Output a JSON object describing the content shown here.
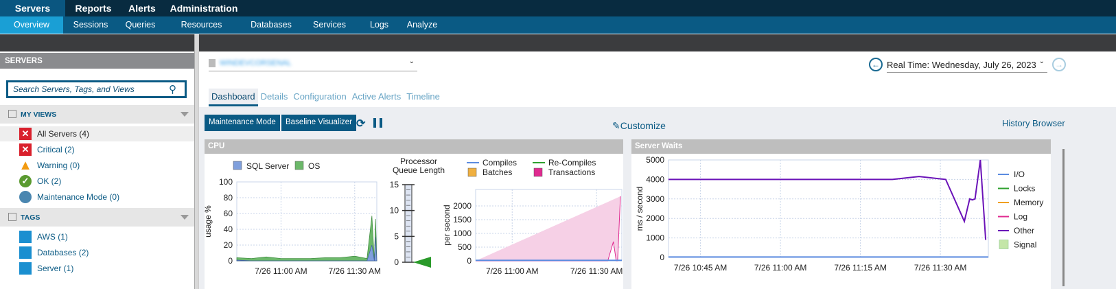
{
  "topnav": [
    "Servers",
    "Reports",
    "Alerts",
    "Administration"
  ],
  "subnav": [
    "Overview",
    "Sessions",
    "Queries",
    "Resources",
    "Databases",
    "Services",
    "Logs",
    "Analyze"
  ],
  "sidebar": {
    "title": "SERVERS",
    "search_placeholder": "Search Servers, Tags, and Views",
    "my_views": {
      "label": "MY VIEWS",
      "items": [
        {
          "label": "All Servers (4)",
          "icon": "critical-x-icon"
        },
        {
          "label": "Critical (2)",
          "icon": "critical-x-icon"
        },
        {
          "label": "Warning (0)",
          "icon": "warning-icon"
        },
        {
          "label": "OK (2)",
          "icon": "ok-check-icon"
        },
        {
          "label": "Maintenance Mode (0)",
          "icon": "maintenance-icon"
        }
      ]
    },
    "tags": {
      "label": "TAGS",
      "items": [
        {
          "label": "AWS (1)"
        },
        {
          "label": "Databases (2)"
        },
        {
          "label": "Server (1)"
        }
      ]
    }
  },
  "header": {
    "server_name": "WINDEVCORSENAL",
    "realtime": "Real Time: Wednesday, July 26, 2023"
  },
  "tabs": [
    "Dashboard",
    "Details",
    "Configuration",
    "Active Alerts",
    "Timeline"
  ],
  "toolbar": {
    "maintenance": "Maintenance Mode",
    "baseline": "Baseline Visualizer",
    "customize": "Customize",
    "history": "History Browser"
  },
  "colors": {
    "sql": "#7f9fdc",
    "os": "#6cb86a",
    "compiles": "#5b8be0",
    "recompiles": "#2ea02e",
    "batches": "#f0b040",
    "transactions": "#e02a90",
    "other": "#6a12b8",
    "signal": "#c4e6a8"
  },
  "chart_data": [
    {
      "type": "area",
      "title": "CPU",
      "ylabel": "usage %",
      "ylim": [
        0,
        100
      ],
      "yticks": [
        0,
        20,
        40,
        60,
        80,
        100
      ],
      "xlim": [
        2,
        59
      ],
      "xticks": [
        {
          "x": 20,
          "label": "7/26 11:00 AM"
        },
        {
          "x": 50,
          "label": "7/26 11:30 AM"
        }
      ],
      "legend": [
        "SQL Server",
        "OS"
      ],
      "series": [
        {
          "name": "OS",
          "x": [
            2,
            8,
            14,
            20,
            26,
            32,
            38,
            44,
            50,
            55,
            57,
            58,
            58.5,
            59
          ],
          "values": [
            4,
            3,
            5,
            3,
            3,
            3,
            4,
            4,
            6,
            3,
            57,
            1,
            53,
            0
          ]
        },
        {
          "name": "SQL Server",
          "x": [
            2,
            8,
            14,
            20,
            26,
            32,
            38,
            44,
            50,
            55,
            57,
            58,
            58.5,
            59
          ],
          "values": [
            1,
            0,
            0,
            0,
            0,
            0,
            0,
            0,
            0,
            0,
            20,
            0,
            30,
            0
          ]
        }
      ]
    },
    {
      "type": "gauge",
      "title": "Processor Queue Length",
      "ylim": [
        0,
        15
      ],
      "yticks": [
        0,
        5,
        10,
        15
      ],
      "value": 0
    },
    {
      "type": "line",
      "ylabel": "per second",
      "ylim": [
        0,
        2600
      ],
      "yticks": [
        0,
        500,
        1000,
        1500,
        2000
      ],
      "xlim": [
        7,
        59
      ],
      "xticks": [
        {
          "x": 20,
          "label": "7/26 11:00 AM"
        },
        {
          "x": 50,
          "label": "7/26 11:30 AM"
        }
      ],
      "legend": [
        "Compiles",
        "Re-Compiles",
        "Batches",
        "Transactions"
      ],
      "series": [
        {
          "name": "Transactions",
          "x": [
            7,
            54,
            56,
            57,
            57.5,
            58.5
          ],
          "values": [
            0,
            0,
            700,
            0,
            0,
            2350
          ]
        },
        {
          "name": "Compiles",
          "x": [
            7,
            59
          ],
          "values": [
            20,
            20
          ]
        }
      ]
    },
    {
      "type": "line",
      "title": "Server Waits",
      "ylabel": "ms / second",
      "ylim": [
        0,
        5000
      ],
      "yticks": [
        0,
        1000,
        2000,
        3000,
        4000,
        5000
      ],
      "xlim": [
        -6,
        54
      ],
      "xticks": [
        {
          "x": 0,
          "label": "7/26 10:45 AM"
        },
        {
          "x": 15,
          "label": "7/26 11:00 AM"
        },
        {
          "x": 30,
          "label": "7/26 11:15 AM"
        },
        {
          "x": 45,
          "label": "7/26 11:30 AM"
        }
      ],
      "legend": [
        "I/O",
        "Locks",
        "Memory",
        "Log",
        "Other",
        "Signal"
      ],
      "series": [
        {
          "name": "Other",
          "x": [
            -6,
            36,
            41,
            46,
            49.5,
            50.5,
            51,
            51.5,
            52.5,
            53.5
          ],
          "values": [
            4000,
            4000,
            4150,
            4000,
            1850,
            3000,
            2950,
            3000,
            5000,
            900
          ]
        },
        {
          "name": "I/O",
          "x": [
            -6,
            54
          ],
          "values": [
            20,
            20
          ]
        }
      ]
    }
  ]
}
